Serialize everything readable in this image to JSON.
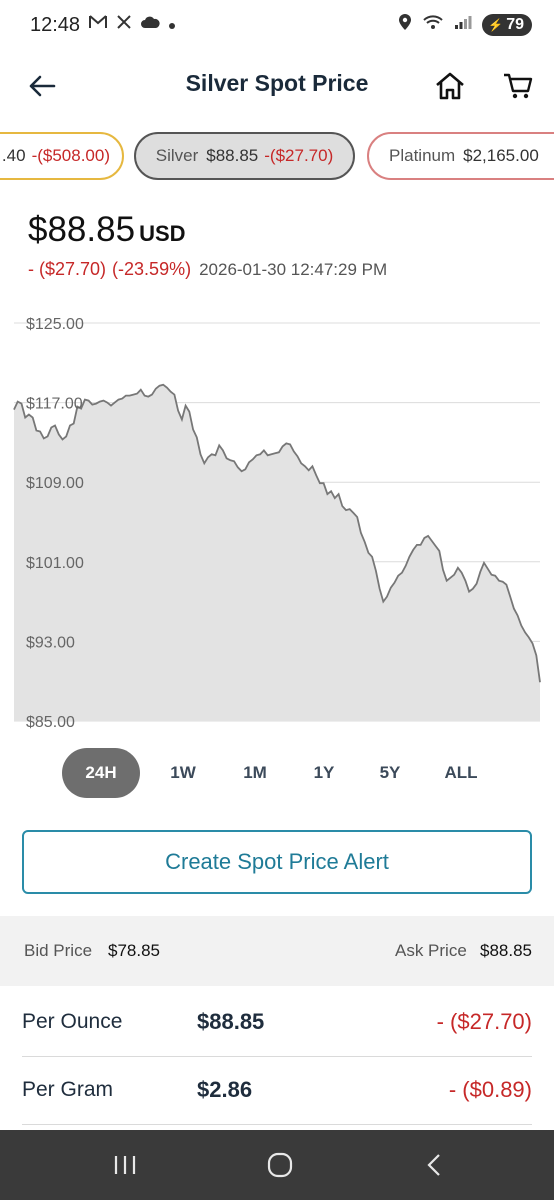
{
  "status": {
    "time": "12:48",
    "battery": "79",
    "left_icons": [
      "gmail-icon",
      "x-icon",
      "cloud-icon",
      "dot-icon"
    ],
    "right_icons": [
      "location-icon",
      "wifi-icon",
      "signal-icon"
    ]
  },
  "header": {
    "title": "Silver Spot Price"
  },
  "metals": [
    {
      "name": "",
      "price": ".40",
      "change": "-($508.00)",
      "color": "#e6b840"
    },
    {
      "name": "Silver",
      "price": "$88.85",
      "change": "-($27.70)",
      "color": "#555555"
    },
    {
      "name": "Platinum",
      "price": "$2,165.00",
      "change": "",
      "color": "#d98080"
    }
  ],
  "spot": {
    "price": "$88.85",
    "currency": "USD",
    "change": "- ($27.70)",
    "change_pct": "(-23.59%)",
    "timestamp": "2026-01-30 12:47:29 PM"
  },
  "chart_data": {
    "type": "area",
    "title": "",
    "xlabel": "",
    "ylabel": "",
    "yticks": [
      "$125.00",
      "$117.00",
      "$109.00",
      "$101.00",
      "$93.00",
      "$85.00"
    ],
    "ylim": [
      85,
      125
    ],
    "grid": true,
    "fill_color": "#e3e3e3",
    "line_color": "#777777",
    "values": [
      116.3,
      117.1,
      116.9,
      115.5,
      115.8,
      115.5,
      114.2,
      114.1,
      113.4,
      113.6,
      114.5,
      114.7,
      113.8,
      113.3,
      113.6,
      114.7,
      114.9,
      116.6,
      116.4,
      117.3,
      117.2,
      116.8,
      116.9,
      117.1,
      117.2,
      117.0,
      116.7,
      117.0,
      117.3,
      117.4,
      117.7,
      117.7,
      117.8,
      117.9,
      118.3,
      117.7,
      117.6,
      117.8,
      118.4,
      118.7,
      118.8,
      118.5,
      118.1,
      117.8,
      116.2,
      115.3,
      116.7,
      116.1,
      114.3,
      113.5,
      111.8,
      110.9,
      111.5,
      111.8,
      111.7,
      112.7,
      112.2,
      111.4,
      111.2,
      111.1,
      110.5,
      110.1,
      110.3,
      111.0,
      111.3,
      111.7,
      111.8,
      112.2,
      111.7,
      111.8,
      111.9,
      112.0,
      112.6,
      112.9,
      112.8,
      112.1,
      111.6,
      110.9,
      110.6,
      110.2,
      110.6,
      109.7,
      108.9,
      108.9,
      107.8,
      108.1,
      107.4,
      107.8,
      106.6,
      106.2,
      106.3,
      105.9,
      105.5,
      103.9,
      103.0,
      101.9,
      101.5,
      100.1,
      98.3,
      97.0,
      97.5,
      98.4,
      98.9,
      99.6,
      99.9,
      100.6,
      101.5,
      102.2,
      102.7,
      102.7,
      103.4,
      103.6,
      103.1,
      102.6,
      102.1,
      100.2,
      99.1,
      99.4,
      99.7,
      100.4,
      99.9,
      99.1,
      98.0,
      98.3,
      98.8,
      100.0,
      100.9,
      100.3,
      99.7,
      99.6,
      99.1,
      99.0,
      98.7,
      97.5,
      96.3,
      95.6,
      94.6,
      93.9,
      93.4,
      92.8,
      91.6,
      88.9
    ]
  },
  "ranges": {
    "items": [
      "24H",
      "1W",
      "1M",
      "1Y",
      "5Y",
      "ALL"
    ],
    "active": "24H"
  },
  "alert": {
    "label": "Create Spot Price Alert"
  },
  "bid_ask": {
    "bid_label": "Bid Price",
    "bid_value": "$78.85",
    "ask_label": "Ask Price",
    "ask_value": "$88.85"
  },
  "rows": [
    {
      "label": "Per Ounce",
      "price": "$88.85",
      "change": "- ($27.70)"
    },
    {
      "label": "Per Gram",
      "price": "$2.86",
      "change": "- ($0.89)"
    }
  ]
}
